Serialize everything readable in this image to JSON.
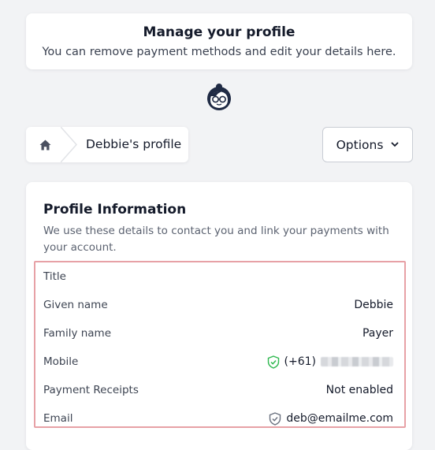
{
  "header": {
    "title": "Manage your profile",
    "subtitle": "You can remove payment methods and edit your details here."
  },
  "breadcrumb": {
    "home_icon": "home-icon",
    "label": "Debbie's profile"
  },
  "options": {
    "label": "Options",
    "icon": "chevron-down-icon"
  },
  "profile": {
    "title": "Profile Information",
    "description": "We use these details to contact you and link your payments with your account.",
    "rows": [
      {
        "label": "Title",
        "value": ""
      },
      {
        "label": "Given name",
        "value": "Debbie"
      },
      {
        "label": "Family name",
        "value": "Payer"
      },
      {
        "label": "Mobile",
        "value": "(+61)",
        "icon": "verified-shield-icon",
        "icon_color": "#2fb84f"
      },
      {
        "label": "Payment Receipts",
        "value": "Not enabled"
      },
      {
        "label": "Email",
        "value": "deb@emailme.com",
        "icon": "shield-icon",
        "icon_color": "#6b7280"
      }
    ]
  },
  "colors": {
    "background": "#f2f3f5",
    "highlight_border": "#e7a1a6",
    "avatar": "#1f2a44"
  }
}
